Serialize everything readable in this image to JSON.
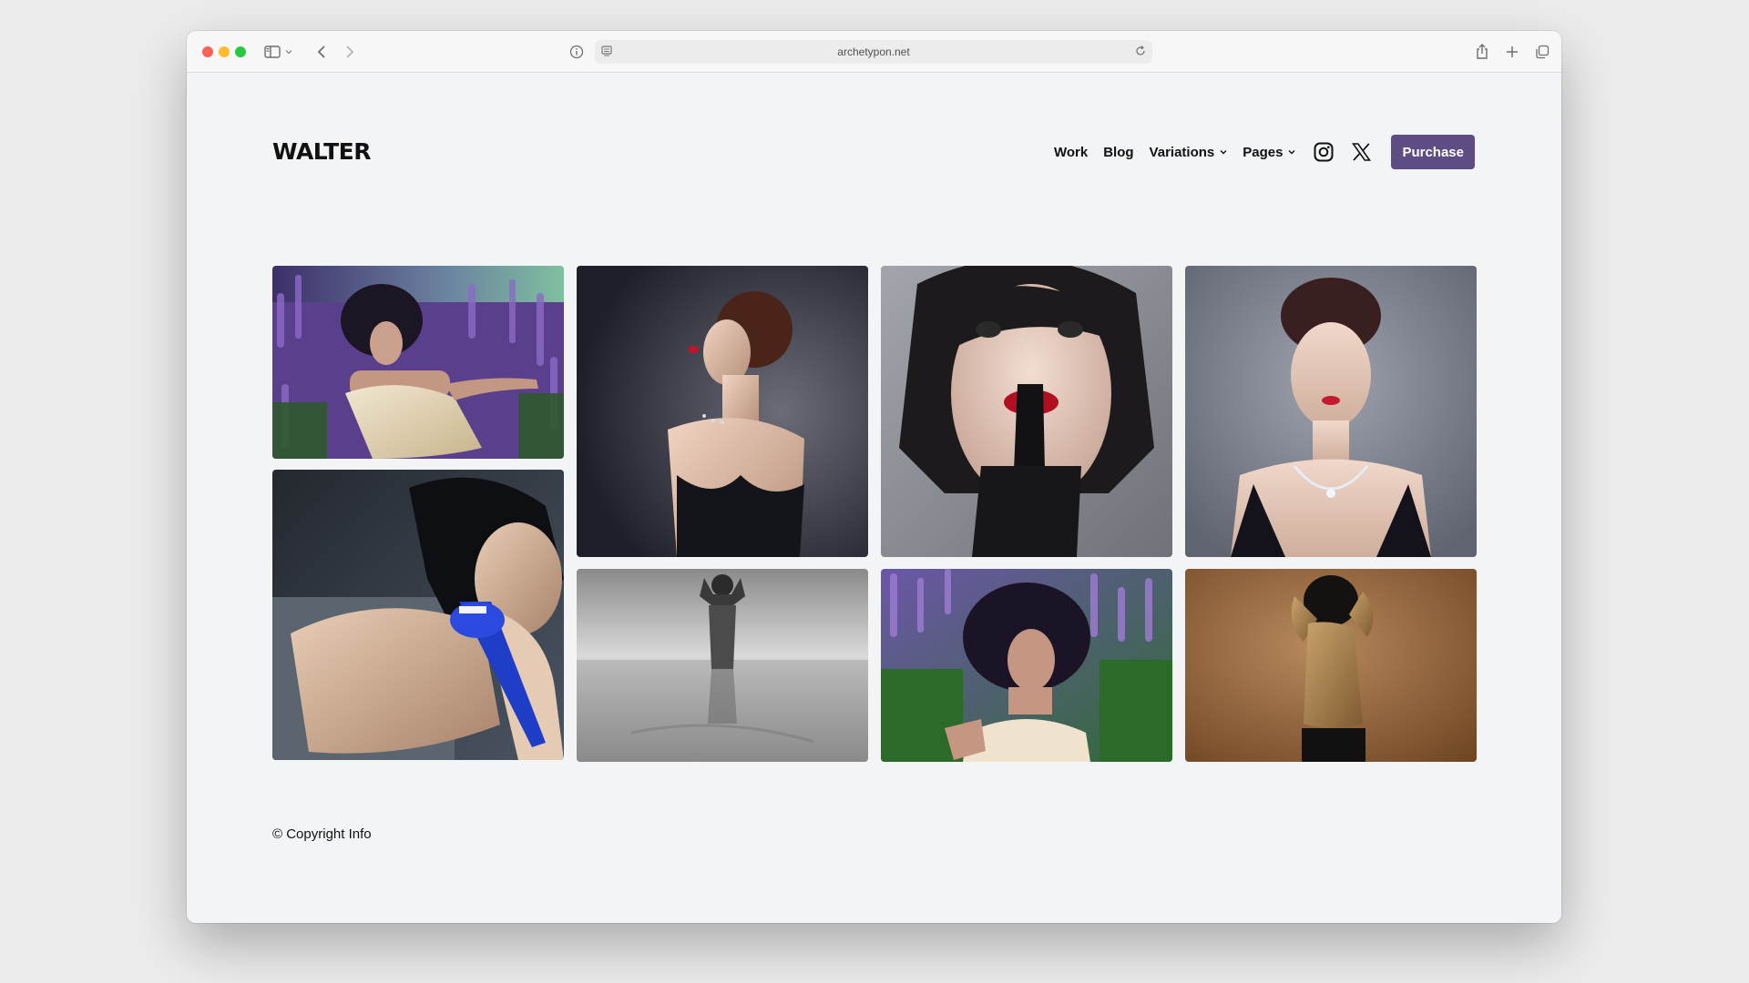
{
  "browser": {
    "url": "archetypon.net"
  },
  "site": {
    "logo": "WALTER",
    "nav": {
      "work": "Work",
      "blog": "Blog",
      "variations": "Variations",
      "pages": "Pages",
      "purchase": "Purchase"
    },
    "social": [
      "instagram-icon",
      "x-icon"
    ],
    "accent_color": "#5e4d85"
  },
  "gallery": {
    "items": [
      {
        "name": "woman-in-lavender-field-reclining"
      },
      {
        "name": "woman-in-black-dress-profile"
      },
      {
        "name": "woman-finger-on-red-lips"
      },
      {
        "name": "woman-with-diamond-necklace"
      },
      {
        "name": "woman-biting-blue-shoe"
      },
      {
        "name": "woman-in-water-black-and-white"
      },
      {
        "name": "woman-in-lavender-field-portrait"
      },
      {
        "name": "woman-back-turned-brown-backdrop"
      }
    ]
  },
  "footer": {
    "copyright": "© Copyright Info"
  }
}
